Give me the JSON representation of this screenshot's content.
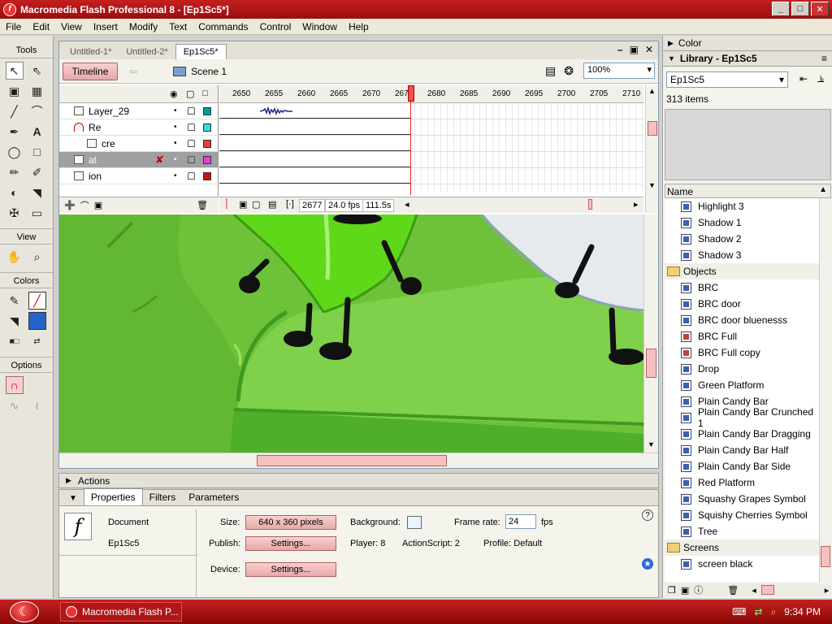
{
  "window": {
    "title": "Macromedia Flash Professional 8 - [Ep1Sc5*]",
    "min": "_",
    "max": "□",
    "close": "✕"
  },
  "menu": [
    "File",
    "Edit",
    "View",
    "Insert",
    "Modify",
    "Text",
    "Commands",
    "Control",
    "Window",
    "Help"
  ],
  "tools": {
    "header": "Tools",
    "view": "View",
    "colors": "Colors",
    "options": "Options"
  },
  "doc": {
    "tabs": [
      "Untitled-1*",
      "Untitled-2*",
      "Ep1Sc5*"
    ],
    "timeline_btn": "Timeline",
    "scene": "Scene 1",
    "zoom": "100%"
  },
  "timeline": {
    "ruler": [
      "2650",
      "2655",
      "2660",
      "2665",
      "2670",
      "2675",
      "2680",
      "2685",
      "2690",
      "2695",
      "2700",
      "2705",
      "2710"
    ],
    "layers": [
      {
        "name": "Layer_29",
        "color": "#009a9a"
      },
      {
        "name": "Re",
        "color": "#33dddd"
      },
      {
        "name": "cre",
        "color": "#e04040"
      },
      {
        "name": "at",
        "color": "#e040e0"
      },
      {
        "name": "ion",
        "color": "#cc1111"
      }
    ],
    "frame": "2677",
    "fps": "24.0 fps",
    "time": "111.5s"
  },
  "panels": {
    "actions": "Actions",
    "color": "Color",
    "library": "Library - Ep1Sc5"
  },
  "props": {
    "tabs": [
      "Properties",
      "Filters",
      "Parameters"
    ],
    "doc_label": "Document",
    "doc_name": "Ep1Sc5",
    "size_label": "Size:",
    "size_value": "640 x 360 pixels",
    "publish_label": "Publish:",
    "settings": "Settings...",
    "device_label": "Device:",
    "bg_label": "Background:",
    "player": "Player: 8",
    "actionscript": "ActionScript:  2",
    "fr_label": "Frame rate:",
    "fr_value": "24",
    "fps": "fps",
    "profile": "Profile:  Default"
  },
  "library": {
    "select": "Ep1Sc5",
    "count": "313 items",
    "col": "Name",
    "items": [
      {
        "name": "Highlight 3",
        "type": "sym"
      },
      {
        "name": "Shadow 1",
        "type": "sym"
      },
      {
        "name": "Shadow 2",
        "type": "sym"
      },
      {
        "name": "Shadow 3",
        "type": "sym"
      },
      {
        "name": "Objects",
        "type": "folder"
      },
      {
        "name": "BRC",
        "type": "sym"
      },
      {
        "name": "BRC door",
        "type": "sym"
      },
      {
        "name": "BRC door bluenesss",
        "type": "sym"
      },
      {
        "name": "BRC Full",
        "type": "btn"
      },
      {
        "name": "BRC Full copy",
        "type": "btn"
      },
      {
        "name": "Drop",
        "type": "sym"
      },
      {
        "name": "Green Platform",
        "type": "sym"
      },
      {
        "name": "Plain Candy Bar",
        "type": "sym"
      },
      {
        "name": "Plain Candy Bar Crunched 1",
        "type": "sym"
      },
      {
        "name": "Plain Candy Bar Dragging",
        "type": "sym"
      },
      {
        "name": "Plain Candy Bar Half",
        "type": "sym"
      },
      {
        "name": "Plain Candy Bar Side",
        "type": "sym"
      },
      {
        "name": "Red Platform",
        "type": "sym"
      },
      {
        "name": "Squashy Grapes Symbol",
        "type": "sym"
      },
      {
        "name": "Squishy Cherries Symbol",
        "type": "sym"
      },
      {
        "name": "Tree",
        "type": "sym"
      },
      {
        "name": "Screens",
        "type": "folder"
      },
      {
        "name": "screen black",
        "type": "sym"
      }
    ]
  },
  "taskbar": {
    "item": "Macromedia Flash P...",
    "clock": "9:34 PM"
  }
}
